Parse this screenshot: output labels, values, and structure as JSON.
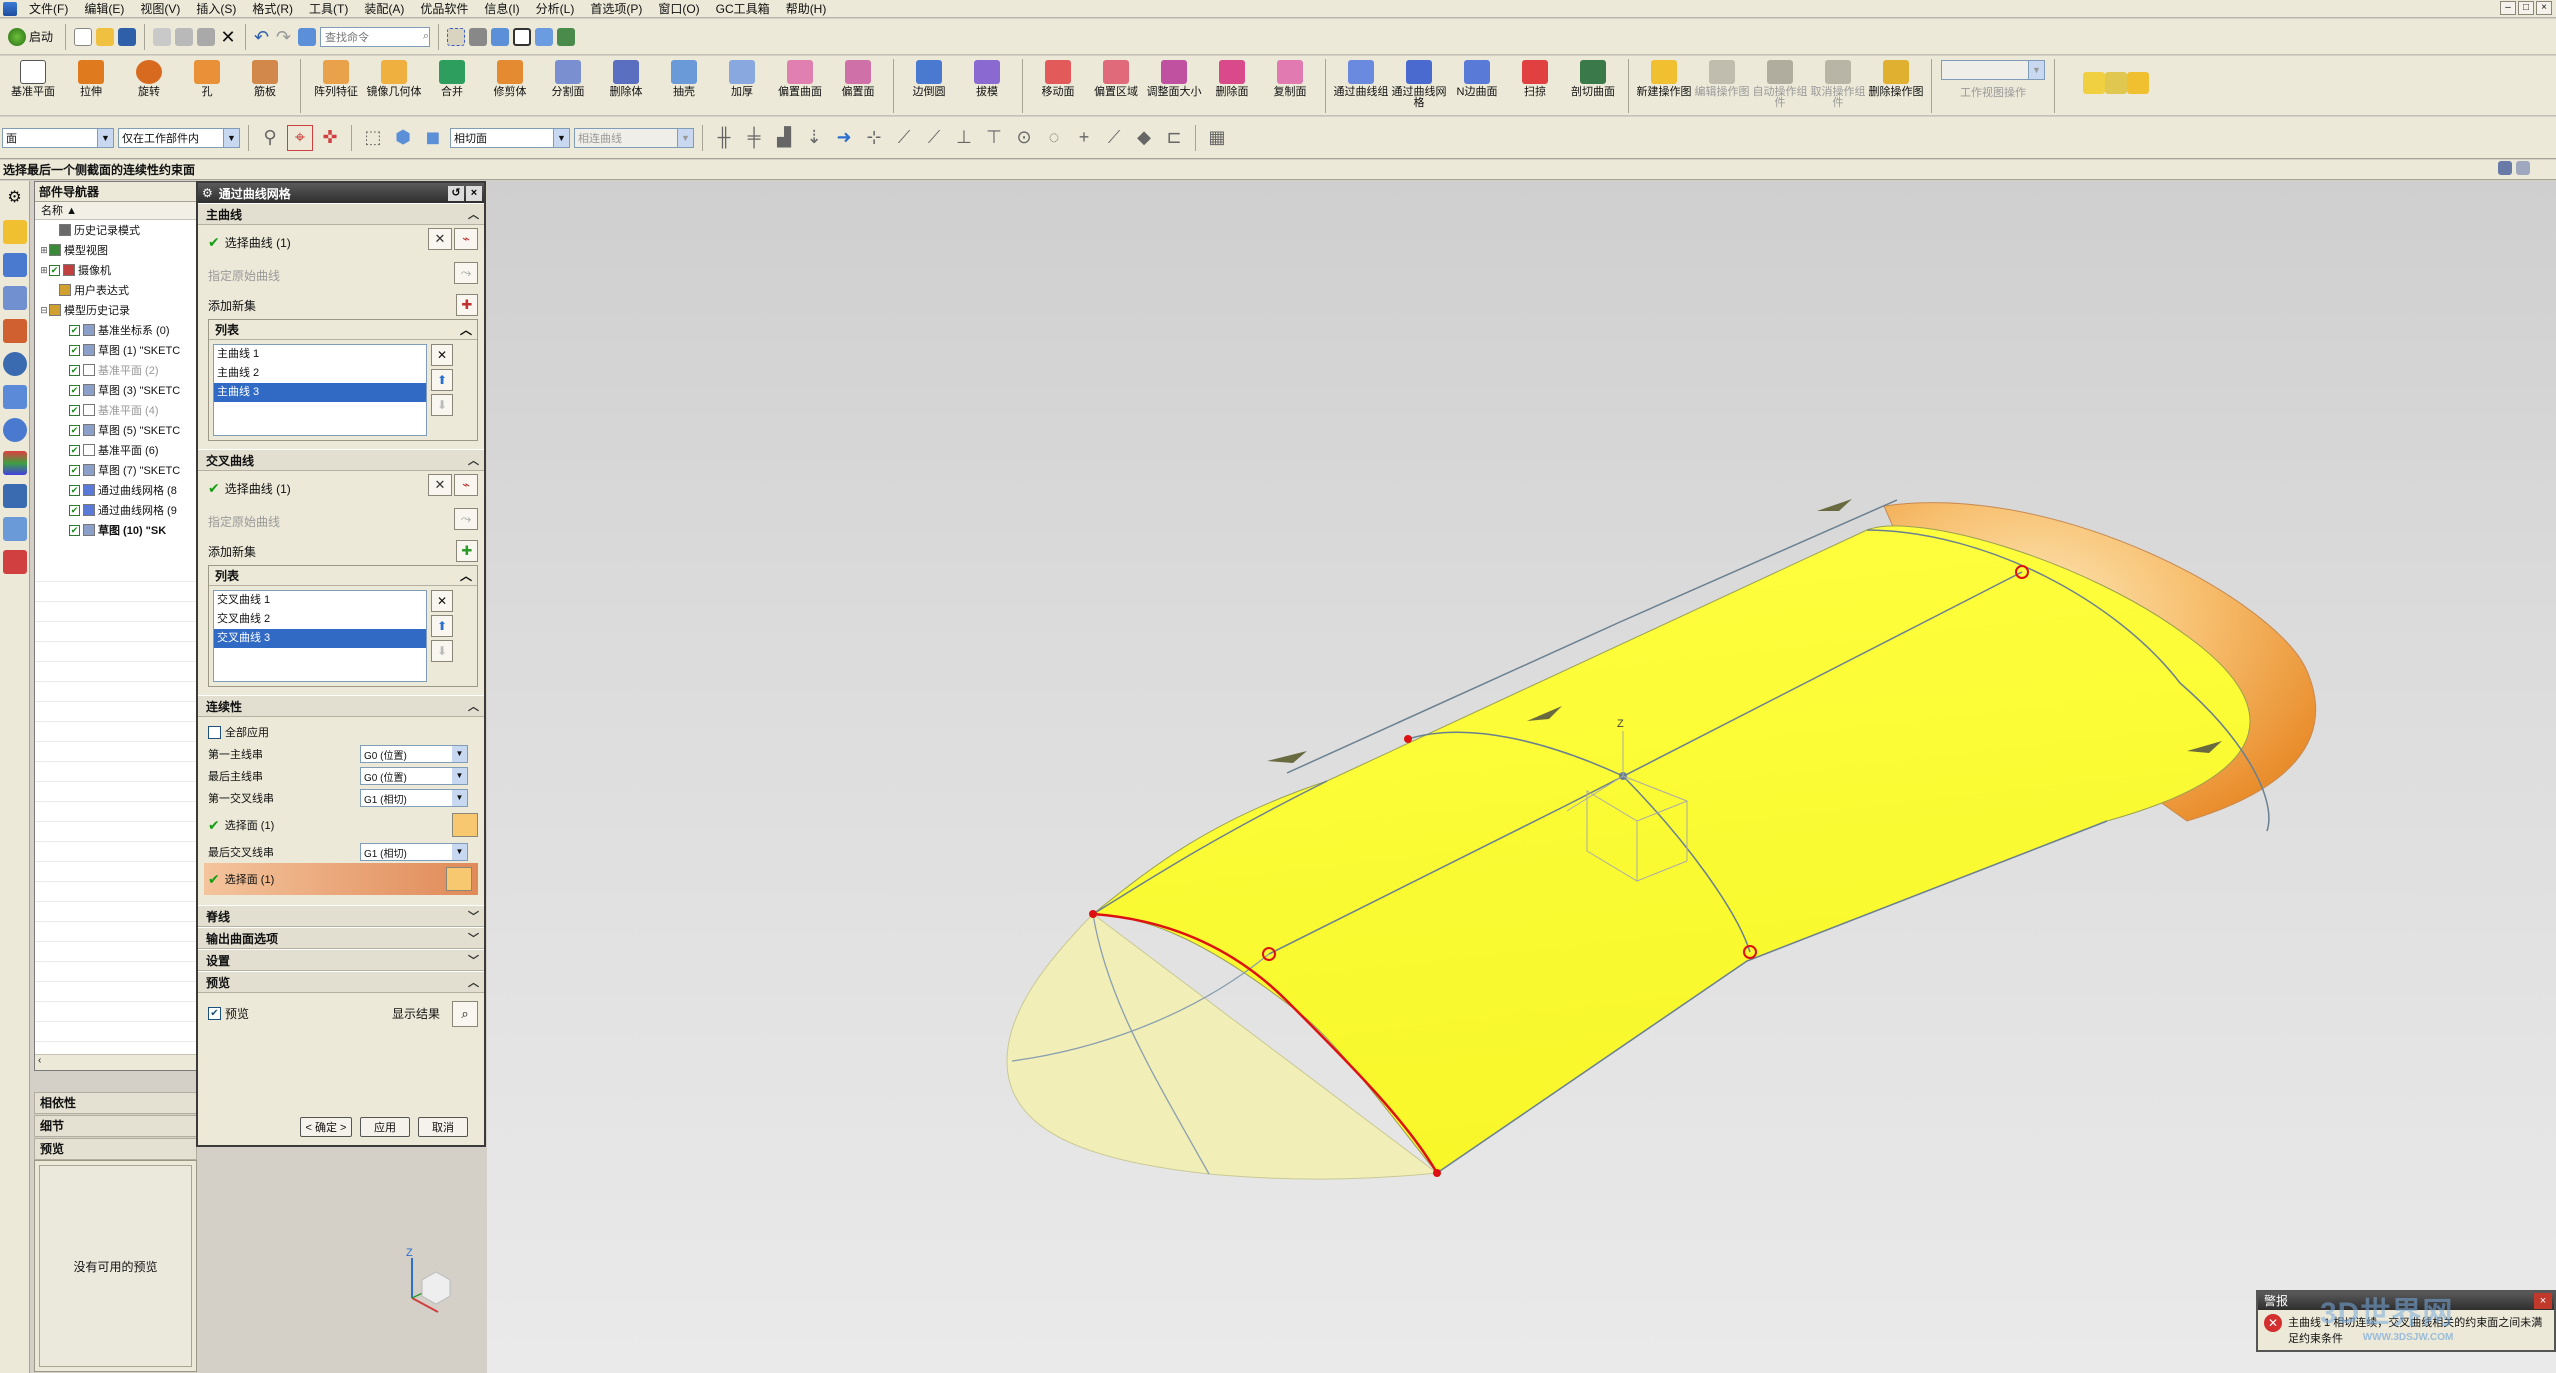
{
  "menubar": {
    "items": [
      "文件(F)",
      "编辑(E)",
      "视图(V)",
      "插入(S)",
      "格式(R)",
      "工具(T)",
      "装配(A)",
      "优品软件",
      "信息(I)",
      "分析(L)",
      "首选项(P)",
      "窗口(O)",
      "GC工具箱",
      "帮助(H)"
    ]
  },
  "toolbar1": {
    "start_label": "启动",
    "search_placeholder": "查找命令"
  },
  "toolbar2": {
    "commands": [
      "基准平面",
      "拉伸",
      "旋转",
      "孔",
      "筋板",
      "阵列特征",
      "镜像几何体",
      "合并",
      "修剪体",
      "分割面",
      "删除体",
      "抽壳",
      "加厚",
      "偏置曲面",
      "偏置面",
      "边倒圆",
      "拔模",
      "移动面",
      "偏置区域",
      "调整面大小",
      "删除面",
      "复制面",
      "通过曲线组",
      "通过曲线网格",
      "N边曲面",
      "扫掠",
      "剖切曲面",
      "新建操作图",
      "编辑操作图",
      "自动操作组件",
      "取消操作组件",
      "删除操作图"
    ],
    "disabled_commands": [
      "编辑操作图",
      "自动操作组件",
      "取消操作组件"
    ],
    "work_view_label": "工作视图操作"
  },
  "toolbar3": {
    "filter_value": "面",
    "scope_value": "仅在工作部件内",
    "face_rule_value": "相切面",
    "curve_rule_value": "相连曲线"
  },
  "cue_line": "选择最后一个侧截面的连续性约束面",
  "part_navigator": {
    "title": "部件导航器",
    "column_header": "名称",
    "rows": [
      {
        "label": "历史记录模式",
        "indent": 1,
        "expander": "",
        "check": false,
        "style": ""
      },
      {
        "label": "模型视图",
        "indent": 0,
        "expander": "+",
        "check": false,
        "style": ""
      },
      {
        "label": "摄像机",
        "indent": 0,
        "expander": "+",
        "check": true,
        "style": ""
      },
      {
        "label": "用户表达式",
        "indent": 1,
        "expander": "",
        "check": false,
        "style": ""
      },
      {
        "label": "模型历史记录",
        "indent": 0,
        "expander": "-",
        "check": false,
        "style": ""
      },
      {
        "label": "基准坐标系 (0)",
        "indent": 2,
        "expander": "",
        "check": true,
        "style": ""
      },
      {
        "label": "草图 (1) \"SKETC",
        "indent": 2,
        "expander": "",
        "check": true,
        "style": ""
      },
      {
        "label": "基准平面 (2)",
        "indent": 2,
        "expander": "",
        "check": true,
        "style": "dim"
      },
      {
        "label": "草图 (3) \"SKETC",
        "indent": 2,
        "expander": "",
        "check": true,
        "style": ""
      },
      {
        "label": "基准平面 (4)",
        "indent": 2,
        "expander": "",
        "check": true,
        "style": "dim"
      },
      {
        "label": "草图 (5) \"SKETC",
        "indent": 2,
        "expander": "",
        "check": true,
        "style": ""
      },
      {
        "label": "基准平面 (6)",
        "indent": 2,
        "expander": "",
        "check": true,
        "style": ""
      },
      {
        "label": "草图 (7) \"SKETC",
        "indent": 2,
        "expander": "",
        "check": true,
        "style": ""
      },
      {
        "label": "通过曲线网格 (8",
        "indent": 2,
        "expander": "",
        "check": true,
        "style": ""
      },
      {
        "label": "通过曲线网格 (9",
        "indent": 2,
        "expander": "",
        "check": true,
        "style": ""
      },
      {
        "label": "草图 (10) \"SK",
        "indent": 2,
        "expander": "",
        "check": true,
        "style": "bold"
      }
    ],
    "sections": [
      "相依性",
      "细节",
      "预览"
    ],
    "preview_empty": "没有可用的预览"
  },
  "dialog": {
    "title": "通过曲线网格",
    "primary": {
      "header": "主曲线",
      "select_label": "选择曲线 (1)",
      "origin_label": "指定原始曲线",
      "add_new_label": "添加新集",
      "list_header": "列表",
      "items": [
        "主曲线 1",
        "主曲线 2",
        "主曲线 3"
      ],
      "selected_index": 2
    },
    "cross": {
      "header": "交叉曲线",
      "select_label": "选择曲线 (1)",
      "origin_label": "指定原始曲线",
      "add_new_label": "添加新集",
      "list_header": "列表",
      "items": [
        "交叉曲线 1",
        "交叉曲线 2",
        "交叉曲线 3"
      ],
      "selected_index": 2
    },
    "continuity": {
      "header": "连续性",
      "apply_all_label": "全部应用",
      "first_primary_label": "第一主线串",
      "first_primary_value": "G0 (位置)",
      "last_primary_label": "最后主线串",
      "last_primary_value": "G0 (位置)",
      "first_cross_label": "第一交叉线串",
      "first_cross_value": "G1 (相切)",
      "select_face_1": "选择面 (1)",
      "last_cross_label": "最后交叉线串",
      "last_cross_value": "G1 (相切)",
      "select_face_2": "选择面 (1)"
    },
    "collapsed_groups": [
      "脊线",
      "输出曲面选项",
      "设置"
    ],
    "preview": {
      "header": "预览",
      "checkbox_label": "预览",
      "show_result_label": "显示结果"
    },
    "buttons": {
      "ok": "< 确定 >",
      "apply": "应用",
      "cancel": "取消"
    }
  },
  "graphics": {
    "main_face_color": "#ffff33",
    "cap_color": "#f6b04c",
    "end_face_color": "#f3efb6",
    "curve_red": "#dd1111",
    "triad_axis": "Z"
  },
  "alert": {
    "title": "警报",
    "message": "主曲线 1 相切连续，交叉曲线相关的约束面之间未满足约束条件",
    "watermark_main": "3D世界网",
    "watermark_sub": "WWW.3DSJW.COM"
  }
}
